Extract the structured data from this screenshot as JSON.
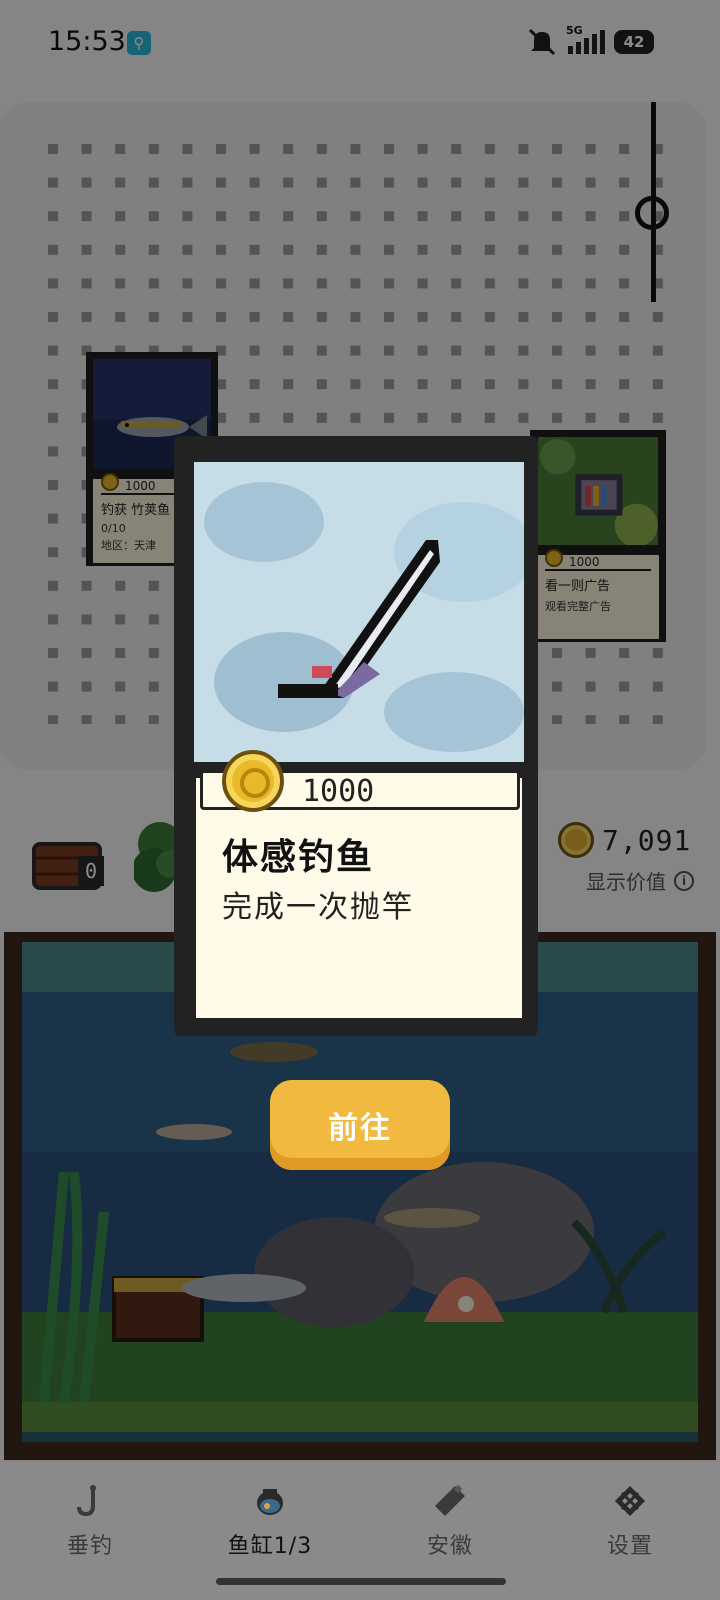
{
  "status_bar": {
    "time": "15:53",
    "network": "5G",
    "battery": "42",
    "icons": [
      "app-notification-icon",
      "mute-icon",
      "signal-icon",
      "battery-icon"
    ]
  },
  "currency": {
    "value": "7,091",
    "label": "显示价值",
    "info_icon": "ⓘ"
  },
  "barrel": {
    "count": "0"
  },
  "side_cards": [
    {
      "price": "1000",
      "title": "钓获 竹荚鱼",
      "progress": "0/10",
      "region": "地区：天津"
    },
    {
      "price": "1000",
      "title": "看一则广告",
      "subtitle": "观看完整广告"
    }
  ],
  "modal": {
    "price": "1000",
    "title": "体感钓鱼",
    "description": "完成一次抛竿",
    "button_label": "前往",
    "item_icon": "sword-icon"
  },
  "bottom_nav": [
    {
      "label": "垂钓",
      "icon": "hook-icon",
      "active": false
    },
    {
      "label": "鱼缸1/3",
      "icon": "fishbowl-icon",
      "active": true
    },
    {
      "label": "安徽",
      "icon": "bottle-icon",
      "active": false
    },
    {
      "label": "设置",
      "icon": "settings-icon",
      "active": false
    }
  ]
}
